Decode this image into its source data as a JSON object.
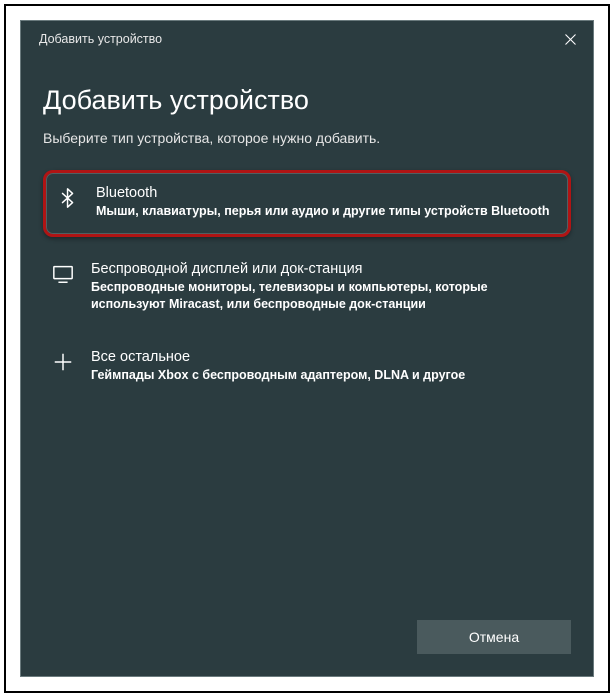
{
  "titlebar": {
    "title": "Добавить устройство"
  },
  "heading": "Добавить устройство",
  "subheading": "Выберите тип устройства, которое нужно добавить.",
  "options": [
    {
      "title": "Bluetooth",
      "desc": "Мыши, клавиатуры, перья или аудио и другие типы устройств Bluetooth"
    },
    {
      "title": "Беспроводной дисплей или док-станция",
      "desc": "Беспроводные мониторы, телевизоры и компьютеры, которые используют Miracast, или беспроводные док-станции"
    },
    {
      "title": "Все остальное",
      "desc": "Геймпады Xbox с беспроводным адаптером, DLNA и другое"
    }
  ],
  "footer": {
    "cancel": "Отмена"
  }
}
